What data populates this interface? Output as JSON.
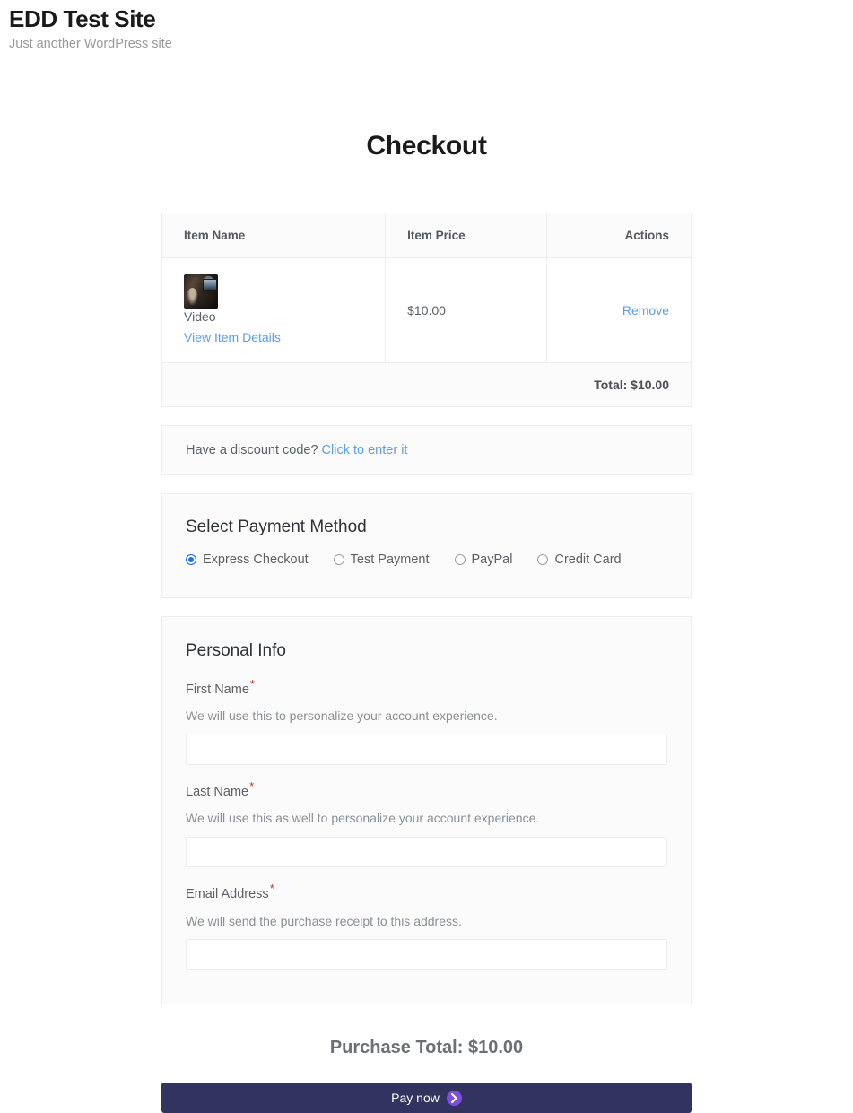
{
  "site": {
    "title": "EDD Test Site",
    "tagline": "Just another WordPress site"
  },
  "page": {
    "title": "Checkout"
  },
  "cart": {
    "headers": {
      "item_name": "Item Name",
      "item_price": "Item Price",
      "actions": "Actions"
    },
    "items": [
      {
        "thumbnail_alt": "product-thumbnail",
        "name": "Video",
        "details_link": "View Item Details",
        "price": "$10.00",
        "remove_label": "Remove"
      }
    ],
    "total_label": "Total: $10.00"
  },
  "discount": {
    "prompt": "Have a discount code?",
    "link": "Click to enter it"
  },
  "payment": {
    "heading": "Select Payment Method",
    "options": [
      {
        "label": "Express Checkout",
        "selected": true
      },
      {
        "label": "Test Payment",
        "selected": false
      },
      {
        "label": "PayPal",
        "selected": false
      },
      {
        "label": "Credit Card",
        "selected": false
      }
    ]
  },
  "personal_info": {
    "heading": "Personal Info",
    "fields": [
      {
        "label": "First Name",
        "required_marker": "*",
        "description": "We will use this to personalize your account experience.",
        "value": "",
        "placeholder": ""
      },
      {
        "label": "Last Name",
        "required_marker": "*",
        "description": "We will use this as well to personalize your account experience.",
        "value": "",
        "placeholder": ""
      },
      {
        "label": "Email Address",
        "required_marker": "*",
        "description": "We will send the purchase receipt to this address.",
        "value": "",
        "placeholder": ""
      }
    ]
  },
  "purchase": {
    "total_label": "Purchase Total: $10.00",
    "pay_button_label": "Pay now",
    "pay_button_icon": "paypal-chevron-icon"
  },
  "colors": {
    "link": "#5b9ee8",
    "required": "#c0392b",
    "radio_selected": "#1a73e8",
    "pay_button_bg": "#333360",
    "paypal_mark": "#7d4ee0"
  }
}
